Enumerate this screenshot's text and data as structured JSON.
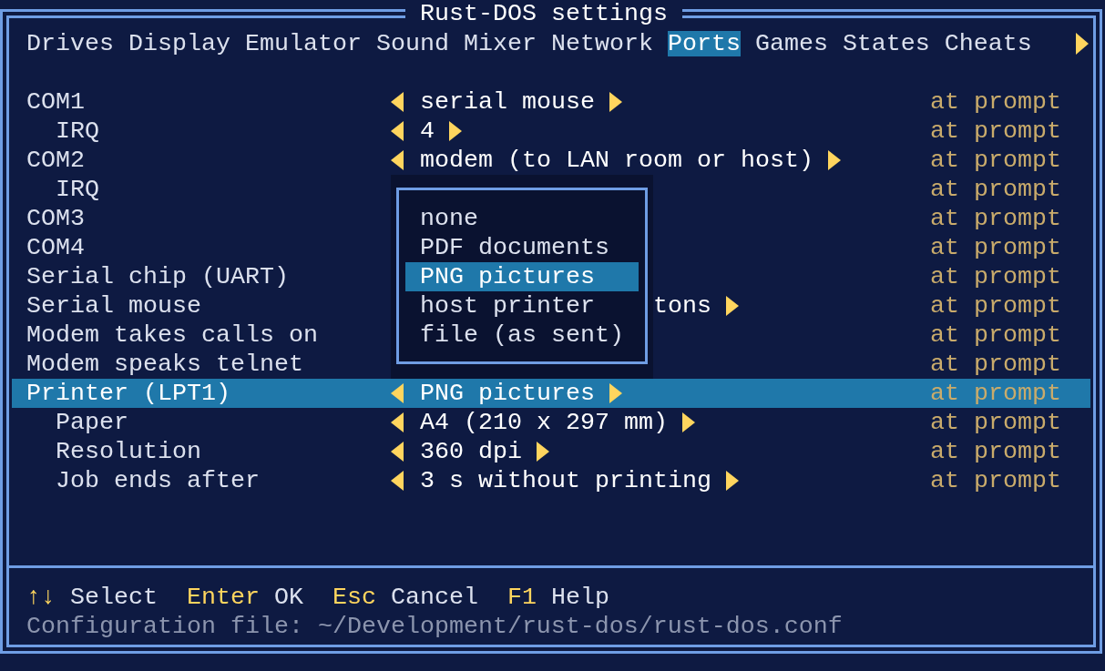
{
  "window": {
    "title": "Rust-DOS settings"
  },
  "tabs": [
    {
      "label": "Drives",
      "selected": false
    },
    {
      "label": "Display",
      "selected": false
    },
    {
      "label": "Emulator",
      "selected": false
    },
    {
      "label": "Sound",
      "selected": false
    },
    {
      "label": "Mixer",
      "selected": false
    },
    {
      "label": "Network",
      "selected": false
    },
    {
      "label": "Ports",
      "selected": true
    },
    {
      "label": "Games",
      "selected": false
    },
    {
      "label": "States",
      "selected": false
    },
    {
      "label": "Cheats",
      "selected": false
    }
  ],
  "settings": [
    {
      "label": "COM1",
      "value": "serial mouse",
      "covered": false,
      "column_3": "at prompt",
      "selected": false,
      "children": [
        {
          "label": "IRQ",
          "value": "4",
          "covered": false,
          "column_3": "at prompt",
          "selected": false
        }
      ]
    },
    {
      "label": "COM2",
      "value": "modem (to LAN room or host)",
      "covered": false,
      "column_3": "at prompt",
      "selected": false,
      "children": [
        {
          "label": "IRQ",
          "column_3": "at prompt",
          "selected": false
        }
      ]
    },
    {
      "label": "COM3",
      "column_3": "at prompt",
      "selected": false
    },
    {
      "label": "COM4",
      "column_3": "at prompt",
      "selected": false
    },
    {
      "label": "Serial chip (UART)",
      "column_3": "at prompt",
      "selected": false
    },
    {
      "label": "Serial mouse",
      "value": "tons",
      "covered": true,
      "column_3": "at prompt",
      "selected": false
    },
    {
      "label": "Modem takes calls on",
      "column_3": "at prompt",
      "selected": false
    },
    {
      "label": "Modem speaks telnet",
      "column_3": "at prompt",
      "selected": false
    },
    {
      "label": "Printer (LPT1)",
      "value": "PNG pictures",
      "covered": false,
      "column_3": "at prompt",
      "selected": true,
      "children": [
        {
          "label": "Paper",
          "value": "A4 (210 x 297 mm)",
          "covered": false,
          "column_3": "at prompt",
          "selected": false
        },
        {
          "label": "Resolution",
          "value": "360 dpi",
          "covered": false,
          "column_3": "at prompt",
          "selected": false
        },
        {
          "label": "Job ends after",
          "value": "3 s without printing",
          "covered": false,
          "column_3": "at prompt",
          "selected": false
        }
      ]
    }
  ],
  "dropdown": {
    "options": [
      {
        "label": "none",
        "selected": false
      },
      {
        "label": "PDF documents",
        "selected": false
      },
      {
        "label": "PNG pictures",
        "selected": true
      },
      {
        "label": "host printer",
        "selected": false
      },
      {
        "label": "file (as sent)",
        "selected": false
      }
    ]
  },
  "shortcuts": [
    {
      "key": "↑↓",
      "action": "Select"
    },
    {
      "key": "Enter",
      "action": "OK"
    },
    {
      "key": "Esc",
      "action": "Cancel"
    },
    {
      "key": "F1",
      "action": "Help"
    }
  ],
  "config_file": "Configuration file: ~/Development/rust-dos/rust-dos.conf"
}
